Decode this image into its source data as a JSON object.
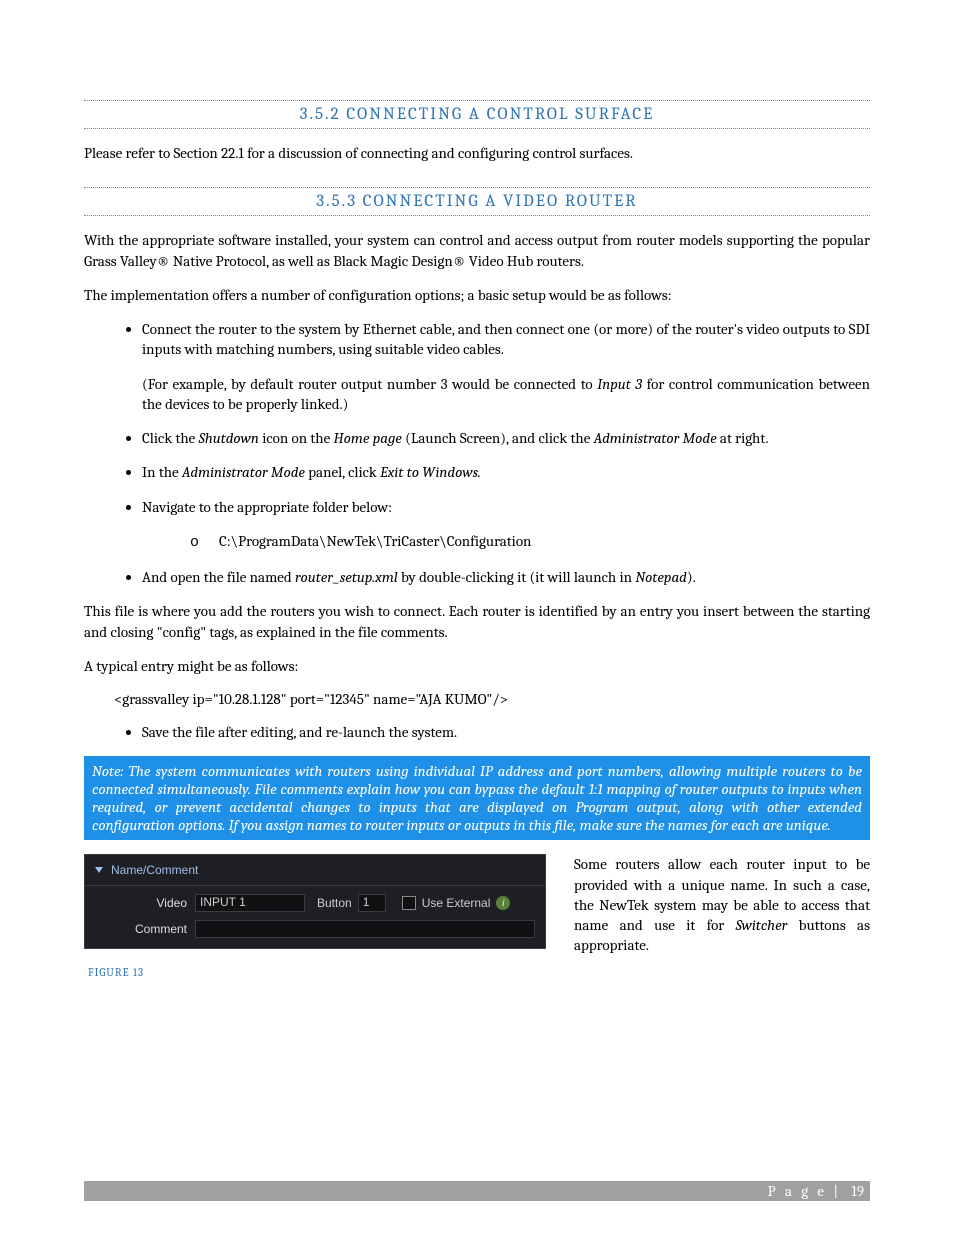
{
  "section352": {
    "title": "3.5.2 CONNECTING A CONTROL SURFACE",
    "body": "Please refer to Section 22.1 for a discussion of connecting and configuring control surfaces."
  },
  "section353": {
    "title": "3.5.3 CONNECTING A VIDEO ROUTER",
    "intro": "With the appropriate software installed, your system can control and access output from router models supporting the popular Grass Valley® Native Protocol, as well as Black Magic Design® Video Hub routers.",
    "options_lead": "The implementation offers a number of configuration options; a basic setup would be as follows:",
    "b1_a": "Connect the router to the system by Ethernet cable, and then connect one (or more) of the router's video outputs to SDI inputs with matching numbers, using suitable video cables.",
    "b1_b_pre": "(For example, by default router output number 3 would be connected to ",
    "b1_b_em": "Input 3",
    "b1_b_post": " for control communication between the devices to be properly linked.)",
    "b2_pre": "Click the ",
    "b2_em1": "Shutdown",
    "b2_mid1": " icon on the ",
    "b2_em2": "Home page",
    "b2_mid2": " (Launch Screen), and click the ",
    "b2_em3": "Administrator Mode",
    "b2_post": " at right.",
    "b3_pre": "In the ",
    "b3_em1": "Administrator Mode",
    "b3_mid": " panel, click ",
    "b3_em2": "Exit to Windows.",
    "b4": "Navigate to the appropriate folder below:",
    "b4_sub": "C:\\ProgramData\\NewTek\\TriCaster\\Configuration",
    "b5_pre": "And open the file named ",
    "b5_em1": "router_setup.xml",
    "b5_mid": " by double-clicking it (it will launch in ",
    "b5_em2": "Notepad",
    "b5_post": ").",
    "after_list": "This file is where you add the routers you wish to connect. Each router is identified by an entry you insert between the starting and closing \"config\" tags, as explained in the file comments.",
    "typical_lead": "A typical entry might be as follows:",
    "example": "<grassvalley ip=\"10.28.1.128\" port=\"12345\" name=\"AJA KUMO\"/>",
    "b6": "Save the file after editing, and re-launch the system.",
    "note": "Note: The system communicates with routers using individual IP address and port numbers, allowing multiple routers to be connected simultaneously.  File comments explain how you can bypass the default 1:1 mapping of router outputs to inputs when required, or prevent accidental changes to inputs that are displayed on Program output, along with other extended configuration options. If you assign names to router inputs or outputs in this file, make sure the names for each are unique."
  },
  "figure": {
    "panel_title": "Name/Comment",
    "video_label": "Video",
    "video_value": "INPUT 1",
    "button_label": "Button",
    "button_value": "1",
    "use_external": "Use External",
    "info_glyph": "i",
    "comment_label": "Comment",
    "comment_value": "",
    "right_text_pre": "Some routers allow each router input to be provided with a unique name.  In such a case, the NewTek system may be able to access that name and use it for ",
    "right_text_em": "Switcher",
    "right_text_post": " buttons as appropriate.",
    "caption": "FIGURE 13"
  },
  "footer": {
    "label": "P a g e",
    "sep": " | ",
    "number": "19"
  }
}
